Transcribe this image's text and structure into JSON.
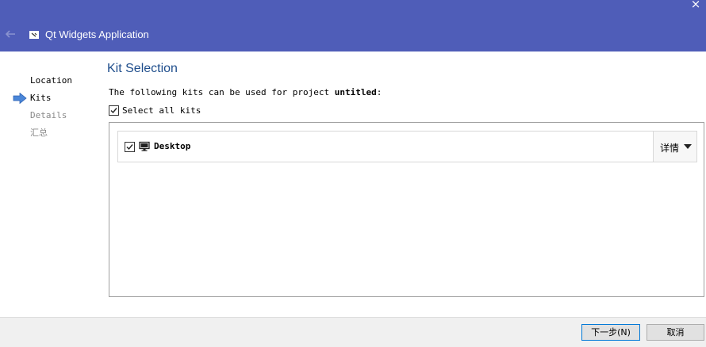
{
  "window": {
    "title": "Qt Widgets Application",
    "close_glyph": "×"
  },
  "steps": [
    {
      "label": "Location",
      "state": "done"
    },
    {
      "label": "Kits",
      "state": "current"
    },
    {
      "label": "Details",
      "state": "todo"
    },
    {
      "label": "汇总",
      "state": "todo"
    }
  ],
  "main": {
    "title": "Kit Selection",
    "intro_prefix": "The following kits can be used for project ",
    "project_name": "untitled",
    "intro_suffix": ":",
    "select_all_label": "Select all kits",
    "select_all_checked": true
  },
  "kits": [
    {
      "name": "Desktop",
      "checked": true,
      "icon": "monitor-icon",
      "details_label": "详情"
    }
  ],
  "footer": {
    "next_label": "下一步(N)",
    "cancel_label": "取消"
  },
  "colors": {
    "titlebar": "#4f5db8",
    "page_title": "#1f4e8c",
    "step_arrow": "#4a86d8",
    "disabled_step": "#8a8a8a"
  }
}
